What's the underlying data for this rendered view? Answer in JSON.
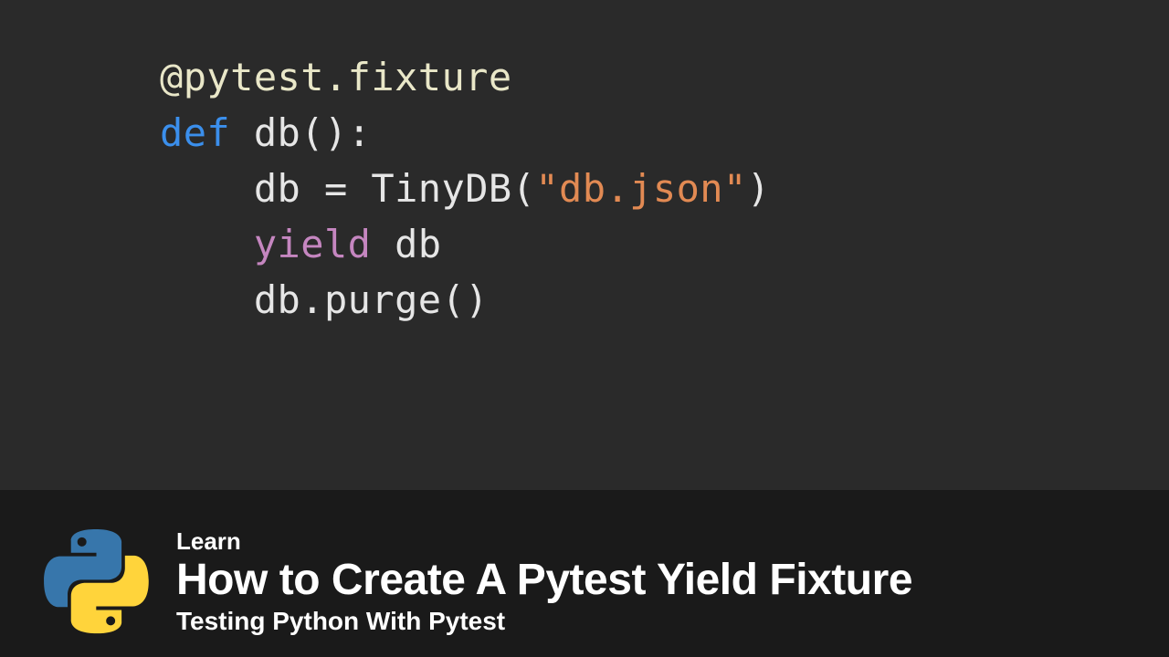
{
  "code": {
    "lines": [
      {
        "indent": 0,
        "tokens": [
          {
            "t": "@pytest.fixture",
            "c": "tok-decorator"
          }
        ]
      },
      {
        "indent": 0,
        "tokens": [
          {
            "t": "def ",
            "c": "tok-keyword"
          },
          {
            "t": "db",
            "c": "tok-funcdef"
          },
          {
            "t": "():",
            "c": "tok-punct"
          }
        ]
      },
      {
        "indent": 1,
        "tokens": [
          {
            "t": "db ",
            "c": "tok-ident"
          },
          {
            "t": "= ",
            "c": "tok-punct"
          },
          {
            "t": "TinyDB",
            "c": "tok-call"
          },
          {
            "t": "(",
            "c": "tok-punct"
          },
          {
            "t": "\"db.json\"",
            "c": "tok-string"
          },
          {
            "t": ")",
            "c": "tok-punct"
          }
        ]
      },
      {
        "indent": 1,
        "tokens": [
          {
            "t": "yield ",
            "c": "tok-keyword-flow"
          },
          {
            "t": "db",
            "c": "tok-ident"
          }
        ]
      },
      {
        "indent": 1,
        "tokens": [
          {
            "t": "db",
            "c": "tok-ident"
          },
          {
            "t": ".",
            "c": "tok-punct"
          },
          {
            "t": "purge",
            "c": "tok-call"
          },
          {
            "t": "()",
            "c": "tok-punct"
          }
        ]
      }
    ]
  },
  "footer": {
    "kicker": "Learn",
    "title": "How to Create A Pytest Yield Fixture",
    "subtitle": "Testing Python With Pytest"
  },
  "colors": {
    "python_blue": "#3776ab",
    "python_yellow": "#ffd43b",
    "code_bg": "#2a2a2a",
    "page_bg": "#1a1a1a"
  }
}
